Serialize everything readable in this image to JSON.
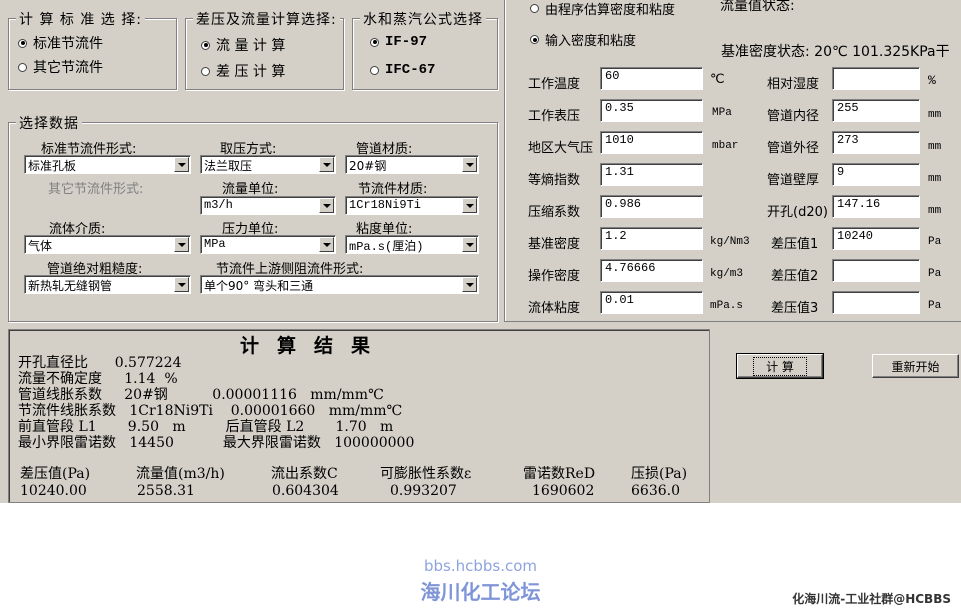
{
  "std_group": {
    "title": "计 算 标 准 选 择:",
    "opt1": "标准节流件",
    "opt2": "其它节流件"
  },
  "calc_group": {
    "title": "差压及流量计算选择:",
    "opt1": "流 量 计 算",
    "opt2": "差 压 计 算"
  },
  "water_group": {
    "title": "水和蒸汽公式选择",
    "opt1": "IF-97",
    "opt2": "IFC-67"
  },
  "select_group": {
    "title": "选择数据",
    "l_element_form": "标准节流件形式:",
    "v_element_form": "标准孔板",
    "l_tap_method": "取压方式:",
    "v_tap_method": "法兰取压",
    "l_pipe_material": "管道材质:",
    "v_pipe_material": "20#钢",
    "l_other_element": "其它节流件形式:",
    "l_flow_unit": "流量单位:",
    "v_flow_unit": "m3/h",
    "l_element_material": "节流件材质:",
    "v_element_material": "1Cr18Ni9Ti",
    "l_fluid": "流体介质:",
    "v_fluid": "气体",
    "l_pressure_unit": "压力单位:",
    "v_pressure_unit": "MPa",
    "l_viscosity_unit": "粘度单位:",
    "v_viscosity_unit": "mPa.s(厘泊)",
    "l_roughness": "管道绝对粗糙度:",
    "v_roughness": "新热轧无缝钢管",
    "l_upstream": "节流件上游侧阻流件形式:",
    "v_upstream": "单个90° 弯头和三通"
  },
  "density_mode": {
    "opt1": "由程序估算密度和粘度",
    "opt2": "输入密度和粘度"
  },
  "flow_state": "流量值状态:",
  "ref_density_state": "基准密度状态: 20℃ 101.325KPa干",
  "params": {
    "temp": {
      "label": "工作温度",
      "value": "60",
      "unit": "℃"
    },
    "pressure": {
      "label": "工作表压",
      "value": "0.35",
      "unit": "MPa"
    },
    "atm": {
      "label": "地区大气压",
      "value": "1010",
      "unit": "mbar"
    },
    "isentropic": {
      "label": "等熵指数",
      "value": "1.31",
      "unit": ""
    },
    "compress": {
      "label": "压缩系数",
      "value": "0.986",
      "unit": ""
    },
    "ref_density": {
      "label": "基准密度",
      "value": "1.2",
      "unit": "kg/Nm3"
    },
    "op_density": {
      "label": "操作密度",
      "value": "4.76666",
      "unit": "kg/m3"
    },
    "viscosity": {
      "label": "流体粘度",
      "value": "0.01",
      "unit": "mPa.s"
    },
    "humidity": {
      "label": "相对湿度",
      "value": "",
      "unit": "%"
    },
    "pipe_id": {
      "label": "管道内径",
      "value": "255",
      "unit": "mm"
    },
    "pipe_od": {
      "label": "管道外径",
      "value": "273",
      "unit": "mm"
    },
    "wall": {
      "label": "管道壁厚",
      "value": "9",
      "unit": "mm"
    },
    "orifice": {
      "label": "开孔(d20)",
      "value": "147.16",
      "unit": "mm"
    },
    "dp1": {
      "label": "差压值1",
      "value": "10240",
      "unit": "Pa"
    },
    "dp2": {
      "label": "差压值2",
      "value": "",
      "unit": "Pa"
    },
    "dp3": {
      "label": "差压值3",
      "value": "",
      "unit": "Pa"
    }
  },
  "result": {
    "title": "计算结果",
    "r1": "开孔直径比      0.577224",
    "r2": "流量不确定度     1.14  %",
    "r3": "管道线胀系数     20#钢          0.00001116   mm/mm℃",
    "r4": "节流件线胀系数   1Cr18Ni9Ti    0.00001660   mm/mm℃",
    "r5": "前直管段 L1       9.50   m         后直管段 L2       1.70   m",
    "r6": "最小界限雷诺数   14450           最大界限雷诺数   100000000",
    "h_dp": "差压值(Pa)",
    "h_flow": "流量值(m3/h)",
    "h_c": "流出系数C",
    "h_eps": "可膨胀性系数ε",
    "h_re": "雷诺数ReD",
    "h_loss": "压损(Pa)",
    "v_dp": "10240.00",
    "v_flow": "2558.31",
    "v_c": "0.604304",
    "v_eps": "0.993207",
    "v_re": "1690602",
    "v_loss": "6636.0"
  },
  "buttons": {
    "calc": "计  算",
    "reset": "重新开始"
  },
  "watermark": {
    "url": "bbs.hcbbs.com",
    "name": "海川化工论坛",
    "corner": "化海川流-工业社群@HCBBS"
  }
}
